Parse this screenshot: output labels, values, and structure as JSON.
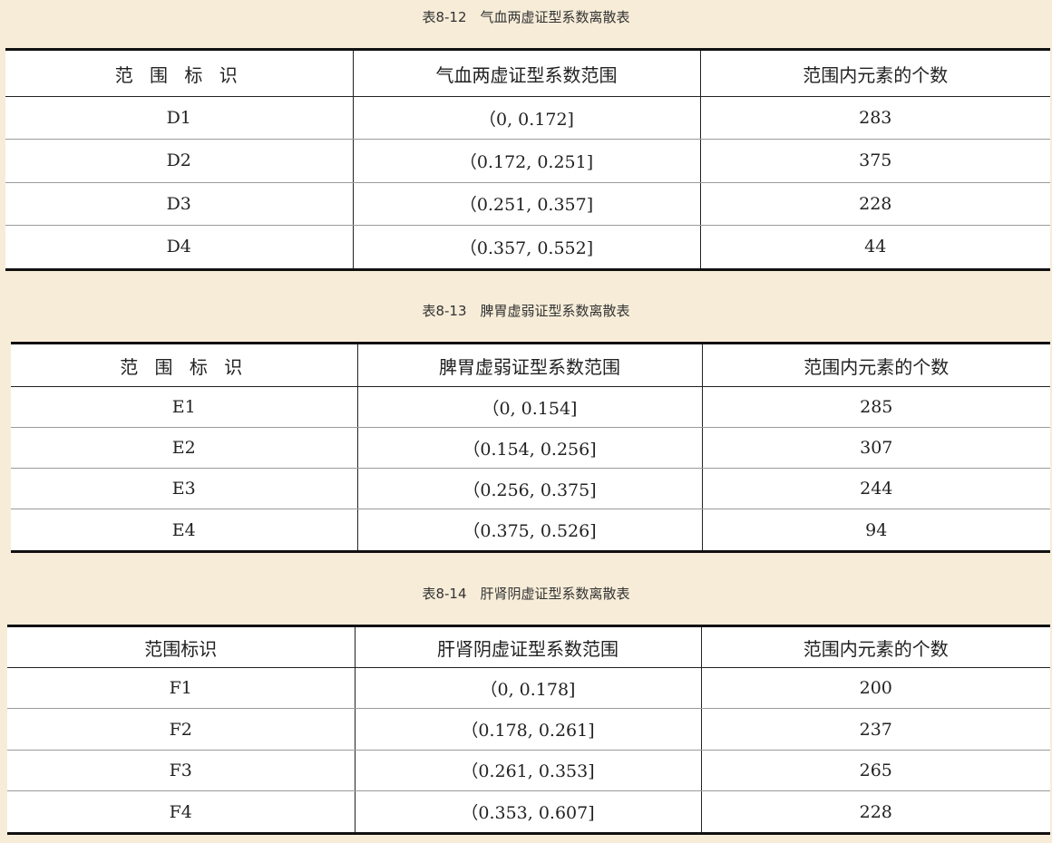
{
  "column_headers": {
    "range_id": "范 围 标 识",
    "range_id_compact": "范围标识",
    "count": "范围内元素的个数"
  },
  "tables": [
    {
      "caption": "表8-12　气血两虚证型系数离散表",
      "range_header": "气血两虚证型系数范围",
      "rows": [
        {
          "id": "D1",
          "range": "（0, 0.172]",
          "count": "283"
        },
        {
          "id": "D2",
          "range": "（0.172, 0.251]",
          "count": "375"
        },
        {
          "id": "D3",
          "range": "（0.251, 0.357]",
          "count": "228"
        },
        {
          "id": "D4",
          "range": "（0.357, 0.552]",
          "count": "44"
        }
      ]
    },
    {
      "caption": "表8-13　脾胃虚弱证型系数离散表",
      "range_header": "脾胃虚弱证型系数范围",
      "rows": [
        {
          "id": "E1",
          "range": "（0, 0.154]",
          "count": "285"
        },
        {
          "id": "E2",
          "range": "（0.154, 0.256]",
          "count": "307"
        },
        {
          "id": "E3",
          "range": "（0.256, 0.375]",
          "count": "244"
        },
        {
          "id": "E4",
          "range": "（0.375, 0.526]",
          "count": "94"
        }
      ]
    },
    {
      "caption": "表8-14　肝肾阴虚证型系数离散表",
      "range_header": "肝肾阴虚证型系数范围",
      "rows": [
        {
          "id": "F1",
          "range": "（0, 0.178]",
          "count": "200"
        },
        {
          "id": "F2",
          "range": "（0.178, 0.261]",
          "count": "237"
        },
        {
          "id": "F3",
          "range": "（0.261, 0.353]",
          "count": "265"
        },
        {
          "id": "F4",
          "range": "（0.353, 0.607]",
          "count": "228"
        }
      ]
    }
  ]
}
